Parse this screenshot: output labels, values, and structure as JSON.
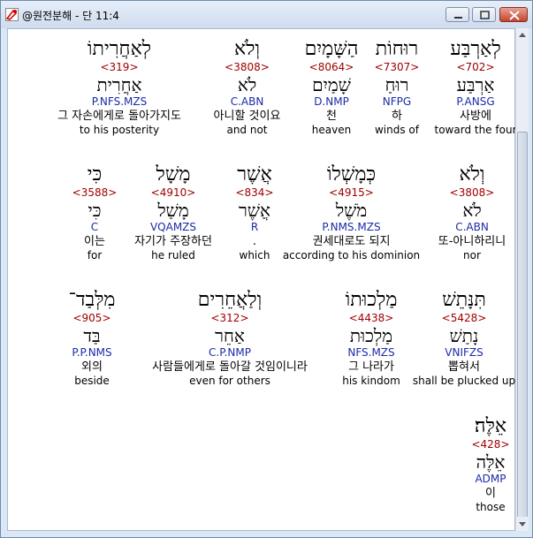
{
  "window": {
    "title": "@원전분해 - 단 11:4"
  },
  "rows": [
    [
      {
        "heb": "לְאַחֲרִיתוֹ",
        "num": "<319>",
        "lemma": "אַחֲרִית",
        "code": "P.NFS.MZS",
        "kor": "그 자손에게로 돌아가지도",
        "eng": "to his posterity"
      },
      {
        "heb": "וְלֹא",
        "num": "<3808>",
        "lemma": "לֹא",
        "code": "C.ABN",
        "kor": "아니할 것이요",
        "eng": "and not"
      },
      {
        "heb": "הַשָּׁמָיִם",
        "num": "<8064>",
        "lemma": "שָׁמַיִם",
        "code": "D.NMP",
        "kor": "천",
        "eng": "heaven"
      },
      {
        "heb": "רוּחוֹת",
        "num": "<7307>",
        "lemma": "רוּחַ",
        "code": "NFPG",
        "kor": "하",
        "eng": "winds of"
      },
      {
        "heb": "לְאַרְבַּע",
        "num": "<702>",
        "lemma": "אַרְבַּע",
        "code": "P.ANSG",
        "kor": "사방에",
        "eng": "toward the four"
      }
    ],
    [
      {
        "heb": "כִּי",
        "num": "<3588>",
        "lemma": "כִּי",
        "code": "C",
        "kor": "이는",
        "eng": "for"
      },
      {
        "heb": "מָשָׁל",
        "num": "<4910>",
        "lemma": "מָשַׁל",
        "code": "VQAMZS",
        "kor": "자기가 주장하던",
        "eng": "he ruled"
      },
      {
        "heb": "אֲשֶׁר",
        "num": "<834>",
        "lemma": "אֲשֶׁר",
        "code": "R",
        "kor": ".",
        "eng": "which"
      },
      {
        "heb": "כְּמָשְׁלוֹ",
        "num": "<4915>",
        "lemma": "מֹשֶׁל",
        "code": "P.NMS.MZS",
        "kor": "권세대로도 되지",
        "eng": "according to his dominion"
      },
      {
        "heb": "וְלֹא",
        "num": "<3808>",
        "lemma": "לֹא",
        "code": "C.ABN",
        "kor": "또-아니하리니",
        "eng": "nor"
      }
    ],
    [
      {
        "heb": "מִלְּבַד־",
        "num": "<905>",
        "lemma": "בַּד",
        "code": "P.P.NMS",
        "kor": "외의",
        "eng": "beside"
      },
      {
        "heb": "וְלַאֲחֵרִים",
        "num": "<312>",
        "lemma": "אַחֵר",
        "code": "C.P.NMP",
        "kor": "사람들에게로 돌아갈 것임이니라",
        "eng": "even for others"
      },
      {
        "heb": "מַלְכוּתוֹ",
        "num": "<4438>",
        "lemma": "מַלְכוּת",
        "code": "NFS.MZS",
        "kor": "그 나라가",
        "eng": "his kindom"
      },
      {
        "heb": "תִּנָּתֵשׁ",
        "num": "<5428>",
        "lemma": "נָתַשׁ",
        "code": "VNIFZS",
        "kor": "뽑혀서",
        "eng": "shall be plucked up"
      }
    ],
    [
      {
        "heb": "אֵלֶּה׃",
        "num": "<428>",
        "lemma": "אֵלֶּה",
        "code": "ADMP",
        "kor": "이",
        "eng": "those"
      }
    ]
  ]
}
